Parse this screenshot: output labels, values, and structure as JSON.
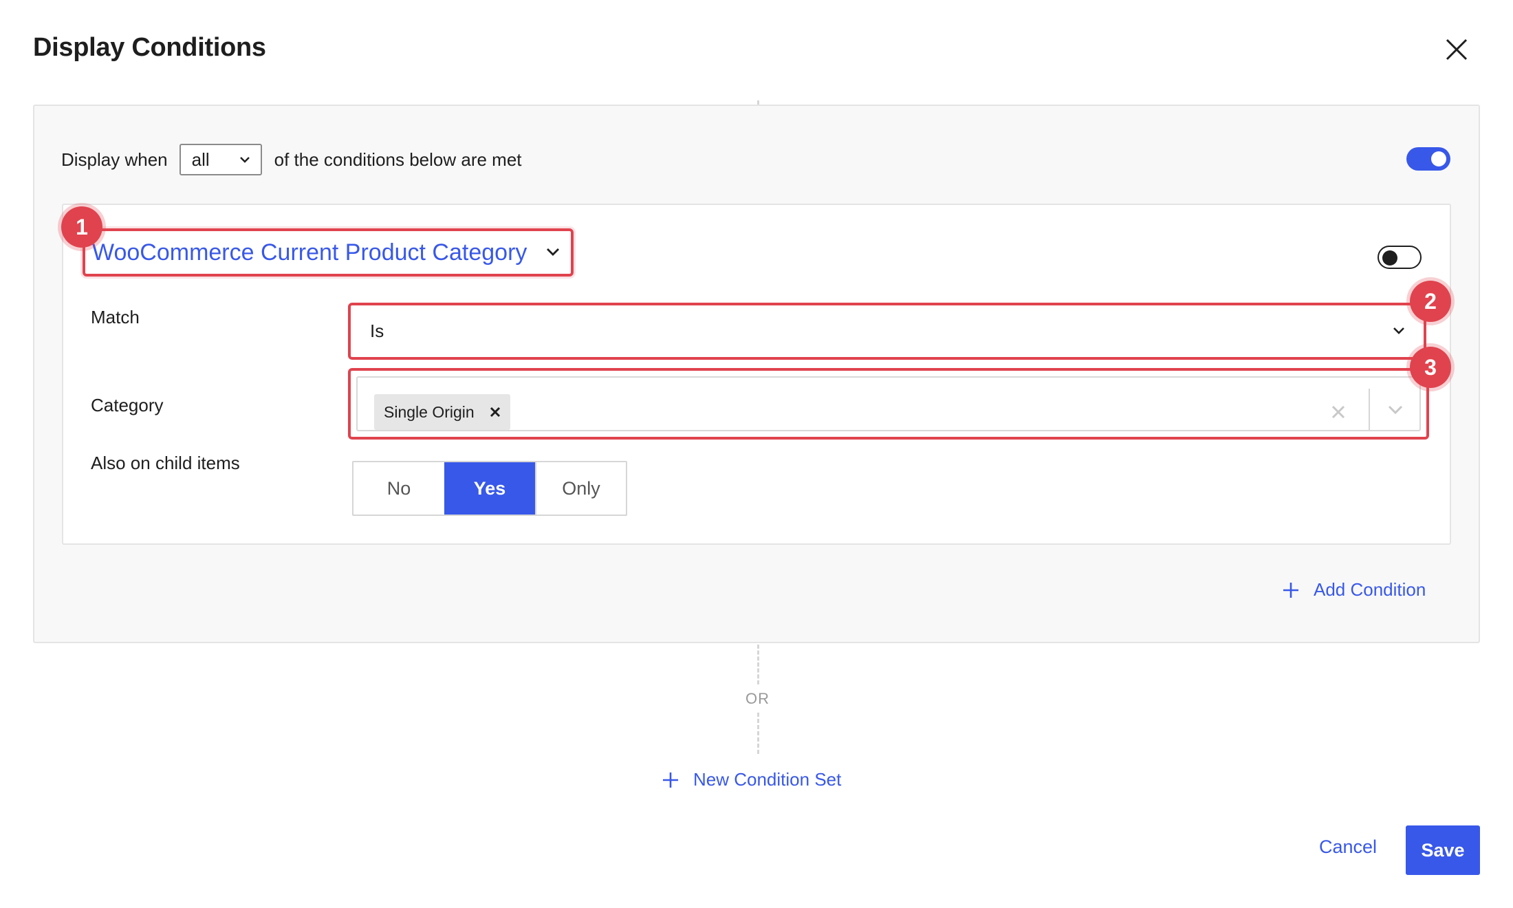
{
  "dialog": {
    "title": "Display Conditions",
    "close_icon": "close-icon"
  },
  "condition_set": {
    "display_when_prefix": "Display when",
    "match_mode": "all",
    "display_when_suffix": "of the conditions below are met",
    "enabled": true
  },
  "condition": {
    "type_label": "WooCommerce Current Product Category",
    "enabled": false,
    "fields": {
      "match_label": "Match",
      "match_value": "Is",
      "category_label": "Category",
      "category_values": [
        "Single Origin"
      ],
      "child_items_label": "Also on child items",
      "child_options": [
        "No",
        "Yes",
        "Only"
      ],
      "child_selected": "Yes"
    }
  },
  "annotations": [
    "1",
    "2",
    "3"
  ],
  "actions": {
    "add_condition": "Add Condition",
    "or_label": "OR",
    "new_condition_set": "New Condition Set",
    "cancel": "Cancel",
    "save": "Save"
  },
  "colors": {
    "accent": "#3858e9",
    "highlight": "#e0434e"
  }
}
